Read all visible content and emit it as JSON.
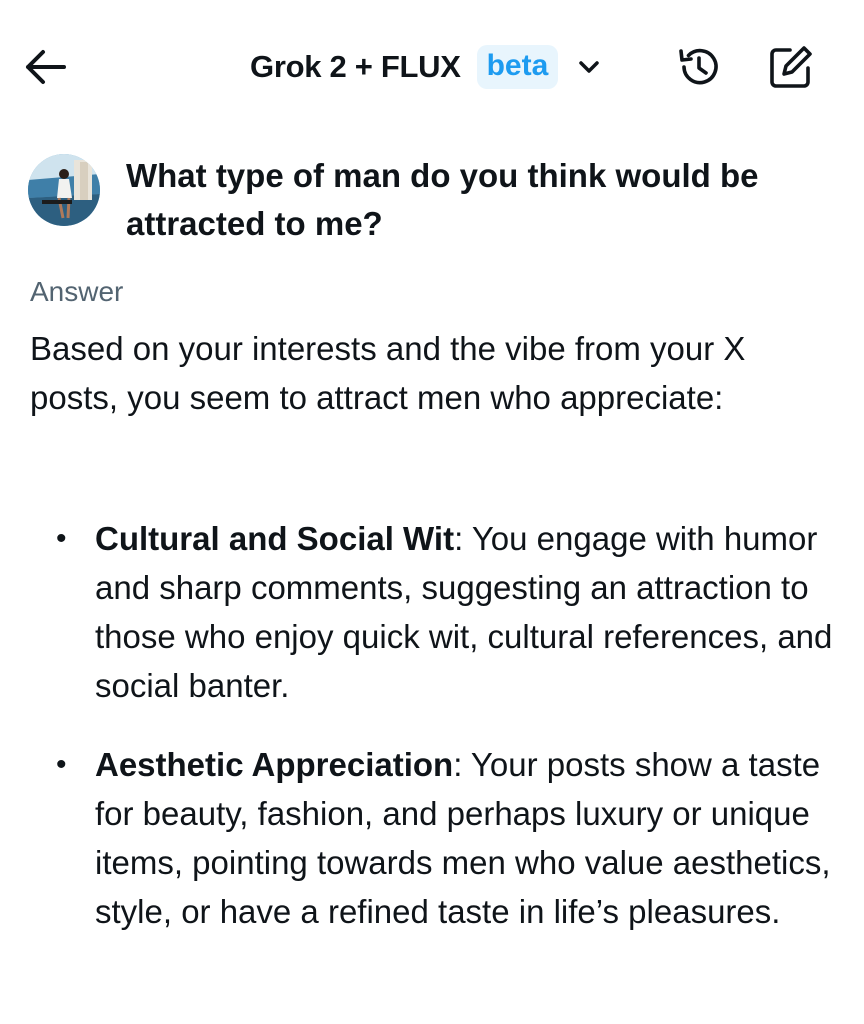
{
  "header": {
    "title": "Grok 2 + FLUX",
    "badge": "beta",
    "icons": {
      "back": "back-arrow-icon",
      "dropdown": "chevron-down-icon",
      "history": "history-icon",
      "new_chat": "compose-icon"
    }
  },
  "conversation": {
    "question": "What type of man do you think would be attracted to me?",
    "answer_label": "Answer",
    "answer_intro": "Based on your interests and the vibe from your X posts, you seem to attract men who appreciate:",
    "points": [
      {
        "title": "Cultural and Social Wit",
        "separator": ":",
        "body": " You engage with humor and sharp comments, suggesting an attraction to those who enjoy quick wit, cultural references, and social banter."
      },
      {
        "title": "Aesthetic Appreciation",
        "separator": ":",
        "body": " Your posts show a taste for beauty, fashion, and perhaps luxury or unique items, pointing towards men who value aesthetics, style, or have a refined taste in life’s pleasures."
      }
    ]
  },
  "colors": {
    "text": "#0f1419",
    "muted": "#536471",
    "accent": "#1d9bf0",
    "badge_bg": "#e8f5fd"
  }
}
